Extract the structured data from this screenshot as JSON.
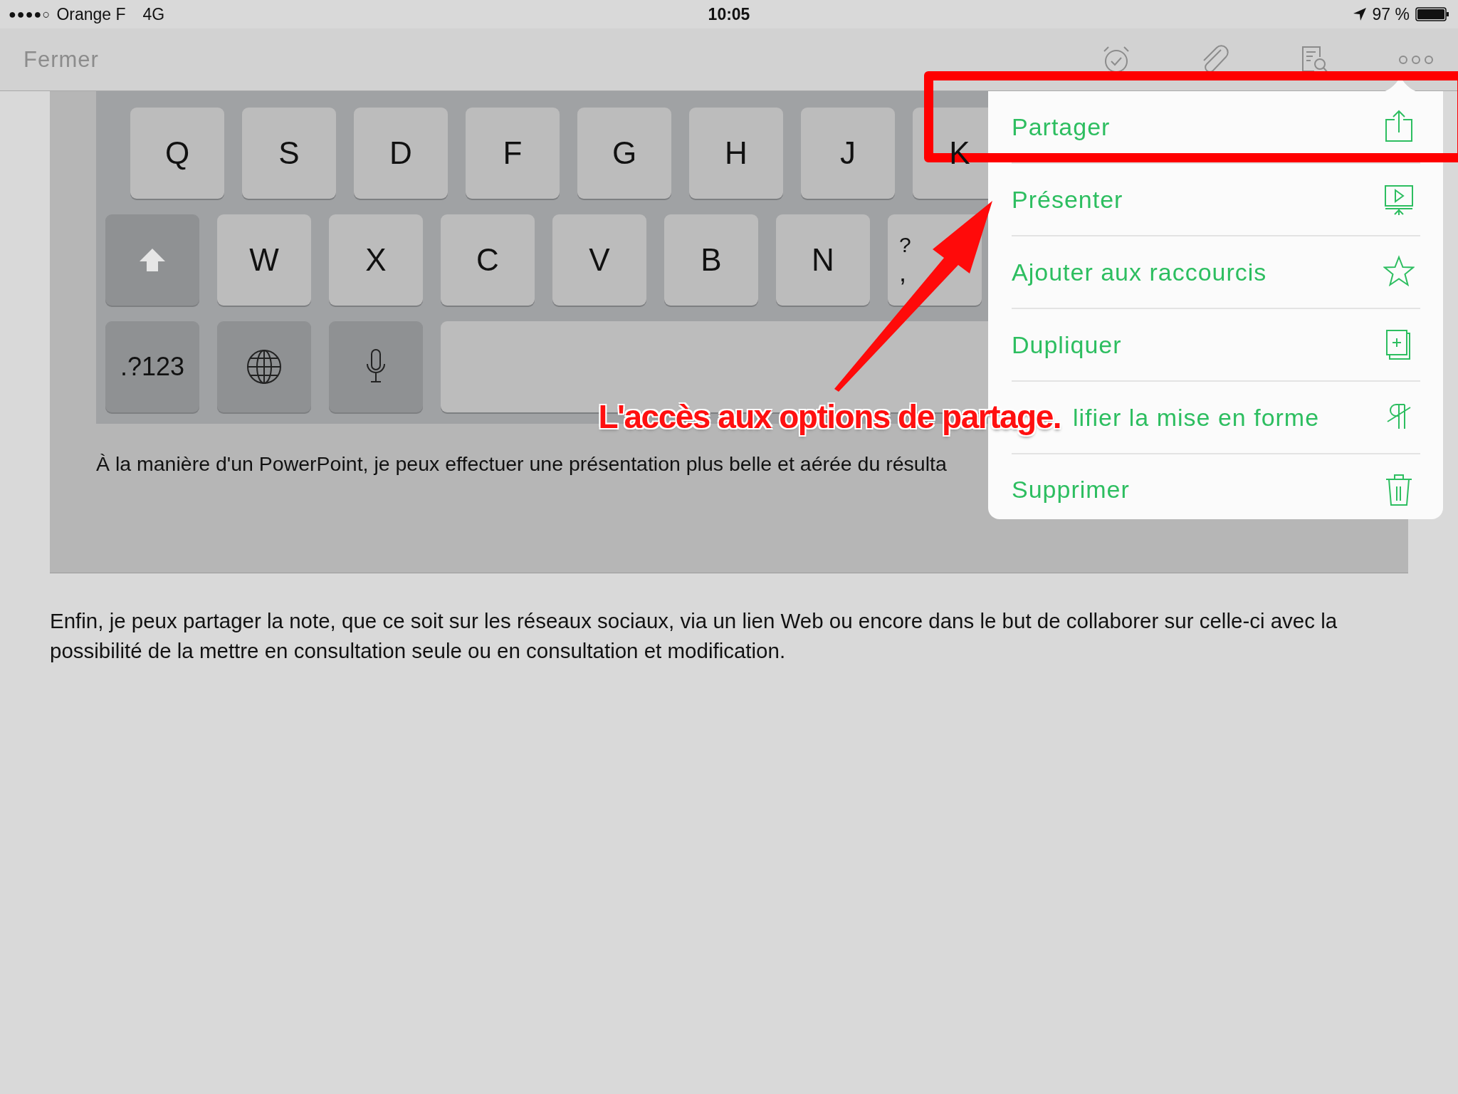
{
  "status_bar": {
    "signal": "●●●●○",
    "carrier": "Orange F",
    "network": "4G",
    "time": "10:05",
    "battery": "97 %"
  },
  "toolbar": {
    "close": "Fermer"
  },
  "screenshot": {
    "keyboard_rows": [
      [
        {
          "kind": "letter",
          "label": "Q"
        },
        {
          "kind": "letter",
          "label": "S"
        },
        {
          "kind": "letter",
          "label": "D"
        },
        {
          "kind": "letter",
          "label": "F"
        },
        {
          "kind": "letter",
          "label": "G"
        },
        {
          "kind": "letter",
          "label": "H"
        },
        {
          "kind": "letter",
          "label": "J"
        },
        {
          "kind": "letter",
          "label": "K"
        }
      ],
      [
        {
          "kind": "shift"
        },
        {
          "kind": "letter",
          "label": "W"
        },
        {
          "kind": "letter",
          "label": "X"
        },
        {
          "kind": "letter",
          "label": "C"
        },
        {
          "kind": "letter",
          "label": "V"
        },
        {
          "kind": "letter",
          "label": "B"
        },
        {
          "kind": "letter",
          "label": "N"
        },
        {
          "kind": "punct",
          "label": ",",
          "alt": "?"
        }
      ],
      [
        {
          "kind": "symbols",
          "label": ".?123"
        },
        {
          "kind": "globe"
        },
        {
          "kind": "mic"
        },
        {
          "kind": "space"
        }
      ]
    ],
    "caption": "À la manière d'un PowerPoint, je peux effectuer une présentation plus belle et aérée du résulta"
  },
  "paragraph": "Enfin, je peux partager la note, que ce soit sur les réseaux sociaux, via un lien Web ou encore dans le but de collaborer sur celle-ci avec la possibilité de la mettre en consultation seule ou en consultation et modification.",
  "menu": {
    "items": [
      {
        "label": "Partager"
      },
      {
        "label": "Présenter"
      },
      {
        "label": "Ajouter aux raccourcis"
      },
      {
        "label": "Dupliquer"
      },
      {
        "label": "lifier la mise en forme"
      },
      {
        "label": "Supprimer"
      }
    ]
  },
  "annotation": {
    "text": "L'accès aux options de partage."
  }
}
